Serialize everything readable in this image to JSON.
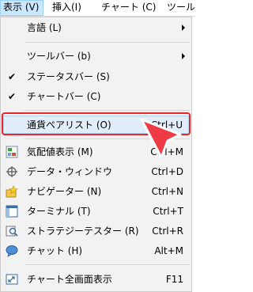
{
  "menubar": {
    "items": [
      {
        "label": "表示 (V)"
      },
      {
        "label": "挿入(I)"
      },
      {
        "label": "チャート (C)"
      },
      {
        "label": "ツール"
      }
    ]
  },
  "menu": {
    "language": {
      "label": "言語 (L)"
    },
    "toolbar": {
      "label": "ツールバー (b)"
    },
    "statusbar": {
      "label": "ステータスバー (S)"
    },
    "chartbar": {
      "label": "チャートバー (C)"
    },
    "pairlist": {
      "label": "通貨ペアリスト (O)",
      "shortcut": "Ctrl+U"
    },
    "quotes": {
      "label": "気配値表示 (M)",
      "shortcut": "Ctrl+M"
    },
    "datawindow": {
      "label": "データ・ウィンドウ",
      "shortcut": "Ctrl+D"
    },
    "navigator": {
      "label": "ナビゲーター (N)",
      "shortcut": "Ctrl+N"
    },
    "terminal": {
      "label": "ターミナル (T)",
      "shortcut": "Ctrl+T"
    },
    "tester": {
      "label": "ストラテジーテスター (R)",
      "shortcut": "Ctrl+R"
    },
    "chat": {
      "label": "チャット (H)",
      "shortcut": "Alt+M"
    },
    "fullscreen": {
      "label": "チャート全画面表示",
      "shortcut": "F11"
    }
  },
  "colors": {
    "highlight_ring": "#e8262b",
    "pointer_arrow": "#ef3b46",
    "active_menu_bg": "#cce8ff"
  }
}
